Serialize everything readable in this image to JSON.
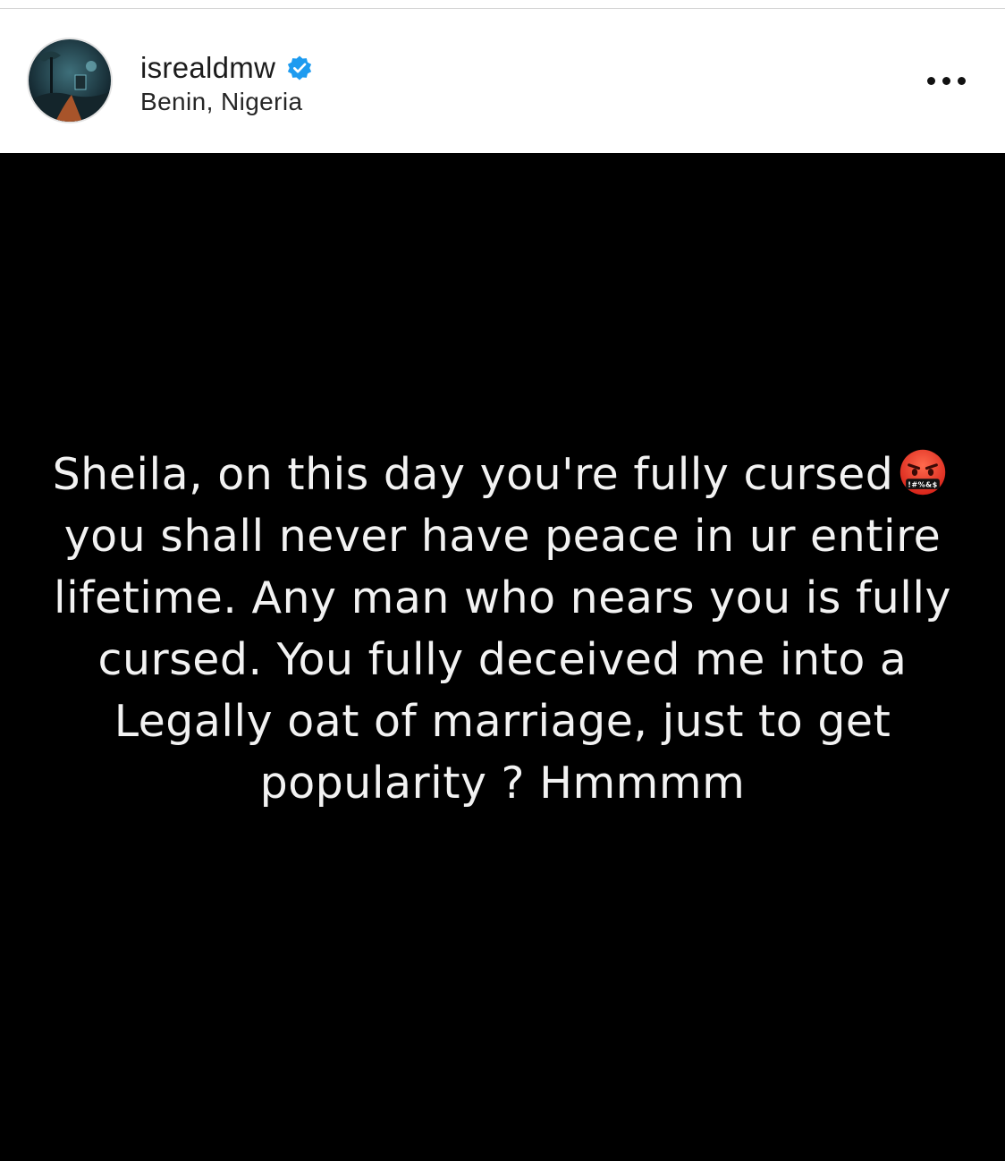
{
  "profile": {
    "username": "isrealdmw",
    "location": "Benin, Nigeria",
    "verified_icon": "verified-badge-icon",
    "avatar_icon": "profile-avatar"
  },
  "colors": {
    "verified_blue": "#1d9bf0",
    "post_background": "#000000",
    "post_text": "#f2f2f2"
  },
  "post": {
    "text_before_emoji": "Sheila, on this day you're fully cursed",
    "emoji": "face-with-symbols-on-mouth-icon",
    "emoji_symbols": "!#%&$",
    "text_after_emoji": "you shall never have peace in ur entire lifetime. Any man who nears you is fully cursed. You fully deceived me into a Legally oat of marriage, just to get popularity ? Hmmmm"
  },
  "menu": {
    "more_icon": "more-options-icon"
  }
}
